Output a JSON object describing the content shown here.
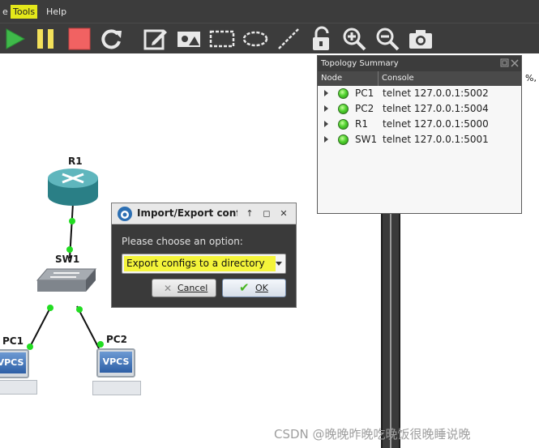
{
  "menubar": {
    "partial_item": "e",
    "items": [
      {
        "label": "Tools",
        "highlighted": true
      },
      {
        "label": "Help",
        "highlighted": false
      }
    ]
  },
  "toolbar": {
    "icons": [
      "play-icon",
      "pause-icon",
      "stop-icon",
      "reload-icon",
      "edit-note-icon",
      "insert-picture-icon",
      "rectangle-icon",
      "ellipse-icon",
      "line-icon",
      "unlock-icon",
      "zoom-in-icon",
      "zoom-out-icon",
      "screenshot-icon"
    ]
  },
  "topology": {
    "nodes": [
      {
        "label": "R1",
        "type": "router"
      },
      {
        "label": "SW1",
        "type": "switch"
      },
      {
        "label": "PC1",
        "type": "vpcs",
        "icon_text": "VPCS"
      },
      {
        "label": "PC2",
        "type": "vpcs",
        "icon_text": "VPCS"
      }
    ]
  },
  "dock": {
    "title": "Topology Summary",
    "columns": [
      "Node",
      "Console"
    ],
    "rows": [
      {
        "node": "PC1",
        "console": "telnet 127.0.0.1:5002"
      },
      {
        "node": "PC2",
        "console": "telnet 127.0.0.1:5004"
      },
      {
        "node": "R1",
        "console": "telnet 127.0.0.1:5000"
      },
      {
        "node": "SW1",
        "console": "telnet 127.0.0.1:5001"
      }
    ],
    "status_color": "#4fd12d",
    "side_text": "%,"
  },
  "dialog": {
    "title": "Import/Export configs",
    "prompt": "Please choose an option:",
    "selected_option": "Export configs to a directory",
    "cancel_label": "Cancel",
    "ok_label": "OK"
  },
  "watermark": "CSDN @晚晚昨晚吃晚饭很晚睡说晚",
  "colors": {
    "highlight": "#e4e81a",
    "link_dot": "#22dd22"
  }
}
